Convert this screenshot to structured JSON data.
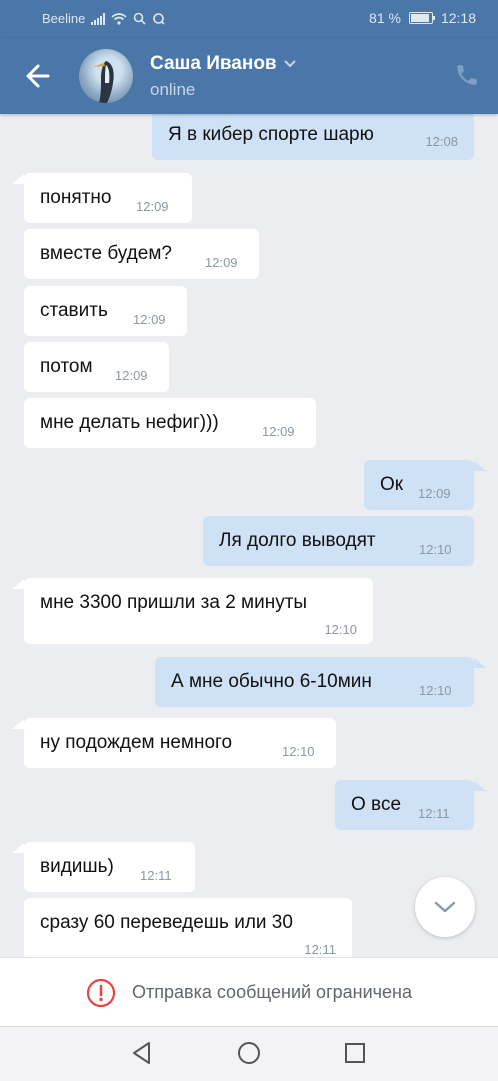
{
  "status_bar": {
    "carrier": "Beeline",
    "battery": "81 %",
    "battery_level": 0.81,
    "time": "12:18"
  },
  "header": {
    "contact_name": "Саша Иванов",
    "status": "online"
  },
  "messages": [
    {
      "text": "Я в кибер спорте шарю",
      "time": "12:08",
      "side": "out"
    },
    {
      "text": "понятно",
      "time": "12:09",
      "side": "in"
    },
    {
      "text": "вместе будем?",
      "time": "12:09",
      "side": "in"
    },
    {
      "text": "ставить",
      "time": "12:09",
      "side": "in"
    },
    {
      "text": "потом",
      "time": "12:09",
      "side": "in"
    },
    {
      "text": "мне делать нефиг)))",
      "time": "12:09",
      "side": "in"
    },
    {
      "text": "Ок",
      "time": "12:09",
      "side": "out"
    },
    {
      "text": "Ля долго выводят",
      "time": "12:10",
      "side": "out"
    },
    {
      "text": "мне 3300 пришли за 2 минуты",
      "time": "12:10",
      "side": "in"
    },
    {
      "text": "А мне обычно 6-10мин",
      "time": "12:10",
      "side": "out"
    },
    {
      "text": "ну подождем немного",
      "time": "12:10",
      "side": "in"
    },
    {
      "text": "О все",
      "time": "12:11",
      "side": "out"
    },
    {
      "text": "видишь)",
      "time": "12:11",
      "side": "in"
    },
    {
      "text": "сразу 60 переведешь или 30",
      "time": "12:11",
      "side": "in"
    }
  ],
  "restriction_notice": "Отправка сообщений ограничена",
  "colors": {
    "header": "#4a76a8",
    "outgoing_bubble": "#cfe1f5",
    "incoming_bubble": "#ffffff",
    "background": "#ebedf0",
    "alert": "#e64646"
  }
}
